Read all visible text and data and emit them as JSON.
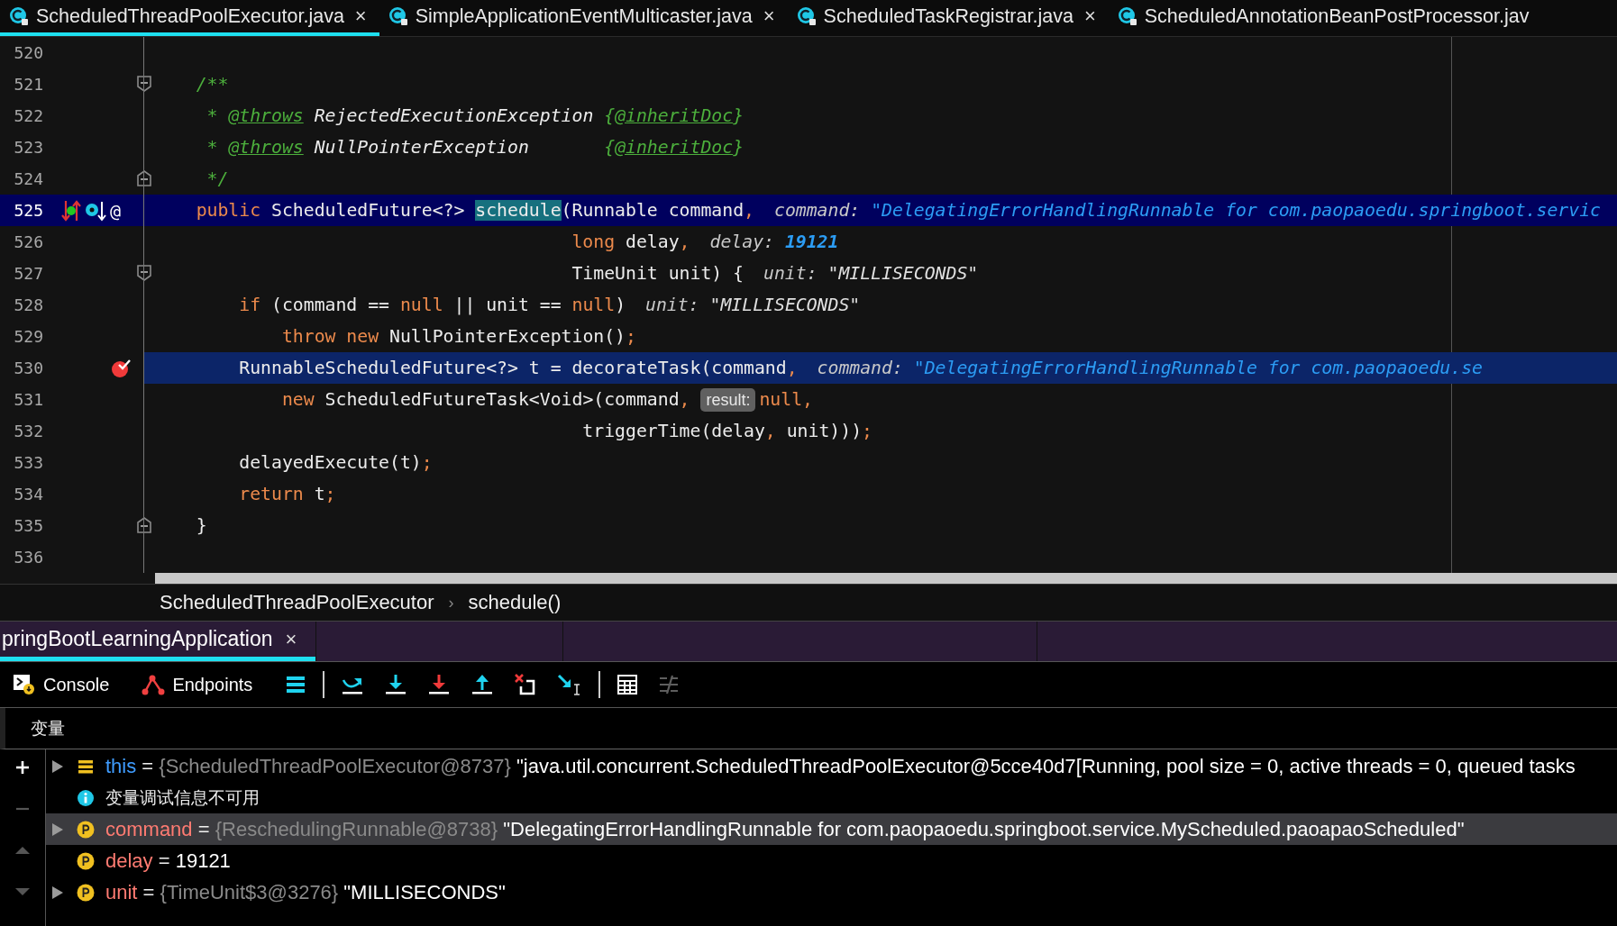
{
  "editor_tabs": [
    {
      "label": "ScheduledThreadPoolExecutor.java",
      "close": "×",
      "selected": true
    },
    {
      "label": "SimpleApplicationEventMulticaster.java",
      "close": "×",
      "selected": false
    },
    {
      "label": "ScheduledTaskRegistrar.java",
      "close": "×",
      "selected": false
    },
    {
      "label": "ScheduledAnnotationBeanPostProcessor.jav",
      "selected": false
    }
  ],
  "editor": {
    "lines": [
      {
        "number": "520",
        "current": false,
        "fold_start": false,
        "fold_end": false,
        "breakpoint": false
      },
      {
        "number": "521",
        "current": false,
        "fold_start": true,
        "fold_end": false,
        "breakpoint": false,
        "segments": [
          {
            "kind": "code",
            "tokens": [
              {
                "t": "    /**",
                "kind": "comment"
              }
            ]
          }
        ]
      },
      {
        "number": "522",
        "current": false,
        "fold_start": false,
        "fold_end": false,
        "breakpoint": false,
        "segments": [
          {
            "kind": "code",
            "tokens": [
              {
                "t": "     * ",
                "kind": "comment"
              },
              {
                "t": "@throws",
                "kind": "doctag"
              },
              {
                "t": " RejectedExecutionException ",
                "kind": "docref"
              },
              {
                "t": "{",
                "kind": "comment"
              },
              {
                "t": "@inheritDoc",
                "kind": "doctag"
              },
              {
                "t": "}",
                "kind": "comment"
              }
            ]
          }
        ]
      },
      {
        "number": "523",
        "current": false,
        "fold_start": false,
        "fold_end": false,
        "breakpoint": false,
        "segments": [
          {
            "kind": "code",
            "tokens": [
              {
                "t": "     * ",
                "kind": "comment"
              },
              {
                "t": "@throws",
                "kind": "doctag"
              },
              {
                "t": " NullPointerException       ",
                "kind": "docref"
              },
              {
                "t": "{",
                "kind": "comment"
              },
              {
                "t": "@inheritDoc",
                "kind": "doctag"
              },
              {
                "t": "}",
                "kind": "comment"
              }
            ]
          }
        ]
      },
      {
        "number": "524",
        "current": false,
        "fold_start": false,
        "fold_end": true,
        "breakpoint": false,
        "segments": [
          {
            "kind": "code",
            "tokens": [
              {
                "t": "     */",
                "kind": "comment"
              }
            ]
          }
        ]
      },
      {
        "number": "525",
        "current": true,
        "fold_start": false,
        "fold_end": false,
        "breakpoint": false,
        "gutter_marks": [
          {
            "kind": "implements"
          },
          {
            "kind": "overridden"
          },
          {
            "kind": "text",
            "text": "@"
          }
        ],
        "segments": [
          {
            "kind": "code",
            "tokens": [
              {
                "t": "    public ",
                "kind": "keyword"
              },
              {
                "t": "ScheduledFuture<?> ",
                "kind": "plain"
              },
              {
                "t": "schedule",
                "kind": "match"
              },
              {
                "t": "(Runnable command",
                "kind": "plain"
              },
              {
                "t": ",",
                "kind": "keyword"
              }
            ]
          },
          {
            "kind": "string",
            "label": "command:",
            "value": "\"DelegatingErrorHandlingRunnable for com.paopaoedu.springboot.servic"
          }
        ]
      },
      {
        "number": "526",
        "current": false,
        "fold_start": false,
        "fold_end": false,
        "breakpoint": false,
        "segments": [
          {
            "kind": "code",
            "tokens": [
              {
                "t": "                                       long",
                "kind": "keyword"
              },
              {
                "t": " delay",
                "kind": "plain"
              },
              {
                "t": ",",
                "kind": "keyword"
              }
            ]
          },
          {
            "kind": "number",
            "label": "delay:",
            "value": "19121"
          }
        ]
      },
      {
        "number": "527",
        "current": false,
        "fold_start": true,
        "fold_end": false,
        "breakpoint": false,
        "segments": [
          {
            "kind": "code",
            "tokens": [
              {
                "t": "                                       TimeUnit unit) {",
                "kind": "plain"
              }
            ]
          },
          {
            "kind": "string",
            "label": "unit:",
            "value": "\"MILLISECONDS\""
          }
        ]
      },
      {
        "number": "528",
        "current": false,
        "fold_start": false,
        "fold_end": false,
        "breakpoint": false,
        "segments": [
          {
            "kind": "code",
            "tokens": [
              {
                "t": "        if",
                "kind": "keyword"
              },
              {
                "t": " (command == ",
                "kind": "plain"
              },
              {
                "t": "null",
                "kind": "keyword"
              },
              {
                "t": " || unit == ",
                "kind": "plain"
              },
              {
                "t": "null",
                "kind": "keyword"
              },
              {
                "t": ")",
                "kind": "plain"
              }
            ]
          },
          {
            "kind": "string",
            "label": "unit:",
            "value": "\"MILLISECONDS\""
          }
        ]
      },
      {
        "number": "529",
        "current": false,
        "fold_start": false,
        "fold_end": false,
        "breakpoint": false,
        "segments": [
          {
            "kind": "code",
            "tokens": [
              {
                "t": "            throw new ",
                "kind": "keyword"
              },
              {
                "t": "NullPointerException()",
                "kind": "plain"
              },
              {
                "t": ";",
                "kind": "keyword"
              }
            ]
          }
        ]
      },
      {
        "number": "530",
        "current": false,
        "fold_start": false,
        "fold_end": false,
        "breakpoint": true,
        "segments": [
          {
            "kind": "code",
            "tokens": [
              {
                "t": "        RunnableScheduledFuture<?> t = decorateTask(command",
                "kind": "plain"
              },
              {
                "t": ",",
                "kind": "keyword"
              }
            ]
          },
          {
            "kind": "string",
            "label": "command:",
            "value": "\"DelegatingErrorHandlingRunnable for com.paopaoedu.se"
          }
        ]
      },
      {
        "number": "531",
        "current": false,
        "fold_start": false,
        "fold_end": false,
        "breakpoint": false,
        "segments": [
          {
            "kind": "code",
            "tokens": [
              {
                "t": "            new ",
                "kind": "keyword"
              },
              {
                "t": "ScheduledFutureTask<Void>(command",
                "kind": "plain"
              },
              {
                "t": ", ",
                "kind": "keyword"
              }
            ]
          },
          {
            "kind": "param",
            "text": "result:"
          },
          {
            "kind": "code",
            "tokens": [
              {
                "t": "null,",
                "kind": "keyword"
              }
            ]
          }
        ]
      },
      {
        "number": "532",
        "current": false,
        "fold_start": false,
        "fold_end": false,
        "breakpoint": false,
        "segments": [
          {
            "kind": "code",
            "tokens": [
              {
                "t": "                                        triggerTime(delay",
                "kind": "plain"
              },
              {
                "t": ", ",
                "kind": "keyword"
              },
              {
                "t": "unit)))",
                "kind": "plain"
              },
              {
                "t": ";",
                "kind": "keyword"
              }
            ]
          }
        ]
      },
      {
        "number": "533",
        "current": false,
        "fold_start": false,
        "fold_end": false,
        "breakpoint": false,
        "segments": [
          {
            "kind": "code",
            "tokens": [
              {
                "t": "        delayedExecute(t)",
                "kind": "plain"
              },
              {
                "t": ";",
                "kind": "keyword"
              }
            ]
          }
        ]
      },
      {
        "number": "534",
        "current": false,
        "fold_start": false,
        "fold_end": false,
        "breakpoint": false,
        "segments": [
          {
            "kind": "code",
            "tokens": [
              {
                "t": "        return ",
                "kind": "keyword"
              },
              {
                "t": "t",
                "kind": "plain"
              },
              {
                "t": ";",
                "kind": "keyword"
              }
            ]
          }
        ]
      },
      {
        "number": "535",
        "current": false,
        "fold_start": false,
        "fold_end": true,
        "breakpoint": false,
        "segments": [
          {
            "kind": "code",
            "tokens": [
              {
                "t": "    }",
                "kind": "plain"
              }
            ]
          }
        ]
      },
      {
        "number": "536",
        "current": false,
        "fold_start": false,
        "fold_end": false,
        "breakpoint": false
      }
    ]
  },
  "breadcrumbs": [
    {
      "label": "ScheduledThreadPoolExecutor"
    },
    {
      "separator": "›",
      "label": "schedule()"
    }
  ],
  "debug_tabs": [
    {
      "label": "pringBootLearningApplication",
      "close": "×",
      "selected": true
    }
  ],
  "toolbar": [
    {
      "kind": "console",
      "label": "Console",
      "disabled": false
    },
    {
      "kind": "endpoints",
      "label": "Endpoints",
      "disabled": false
    },
    {
      "kind": "frames",
      "disabled": false
    },
    {
      "kind": "separator"
    },
    {
      "kind": "step_over",
      "disabled": false
    },
    {
      "kind": "step_into",
      "disabled": false
    },
    {
      "kind": "force_step_into",
      "disabled": false
    },
    {
      "kind": "step_out",
      "disabled": false
    },
    {
      "kind": "drop_frame",
      "disabled": false
    },
    {
      "kind": "run_to_cursor",
      "disabled": false
    },
    {
      "kind": "separator"
    },
    {
      "kind": "evaluate",
      "disabled": false
    },
    {
      "kind": "trace",
      "disabled": true
    }
  ],
  "variables": {
    "header": "变量",
    "side_buttons": [
      {
        "kind": "add",
        "disabled": false
      },
      {
        "kind": "remove",
        "disabled": true
      },
      {
        "kind": "up",
        "disabled": true
      },
      {
        "kind": "down",
        "disabled": true
      }
    ],
    "rows": [
      {
        "kind": "field",
        "expandable": true,
        "selected": false,
        "name": "this",
        "operator": "=",
        "type": "{ScheduledThreadPoolExecutor@8737}",
        "value": "\"java.util.concurrent.ScheduledThreadPoolExecutor@5cce40d7[Running, pool size = 0, active threads = 0, queued tasks"
      },
      {
        "kind": "info",
        "expandable": false,
        "selected": false,
        "text": "变量调试信息不可用"
      },
      {
        "kind": "param",
        "expandable": true,
        "selected": true,
        "name": "command",
        "operator": "=",
        "type": "{ReschedulingRunnable@8738}",
        "value": "\"DelegatingErrorHandlingRunnable for com.paopaoedu.springboot.service.MyScheduled.paoapaoScheduled\""
      },
      {
        "kind": "param",
        "expandable": false,
        "selected": false,
        "name": "delay",
        "operator": "=",
        "value": "19121"
      },
      {
        "kind": "param",
        "expandable": true,
        "selected": false,
        "name": "unit",
        "operator": "=",
        "type": "{TimeUnit$3@3276}",
        "value": "\"MILLISECONDS\""
      }
    ]
  }
}
